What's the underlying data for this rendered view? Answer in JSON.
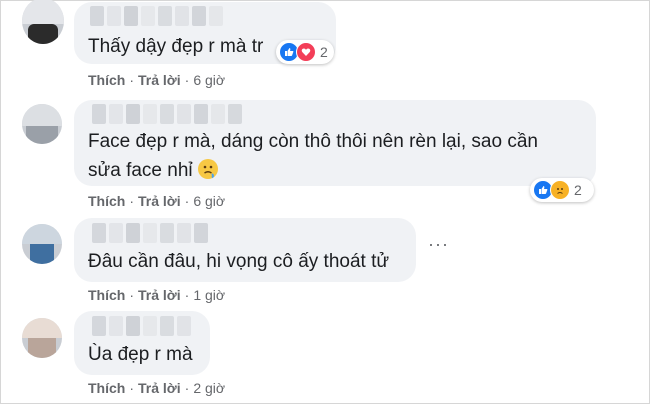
{
  "comments": [
    {
      "text": "Thấy dậy đẹp r mà tr",
      "like_label": "Thích",
      "reply_label": "Trả lời",
      "time": "6 giờ",
      "reactions": {
        "types": [
          "like-icon",
          "love-icon"
        ],
        "count": "2"
      }
    },
    {
      "text_line1": "Face đẹp r mà, dáng còn thô thôi nên rèn lại, sao cần",
      "text_line2": "sửa face nhỉ",
      "emoji": "thinking-sad-face-icon",
      "like_label": "Thích",
      "reply_label": "Trả lời",
      "time": "6 giờ",
      "reactions": {
        "types": [
          "like-icon",
          "sad-icon"
        ],
        "count": "2"
      }
    },
    {
      "text": "Đâu cần đâu, hi vọng cô ấy thoát tử",
      "like_label": "Thích",
      "reply_label": "Trả lời",
      "time": "1 giờ",
      "more_label": "···"
    },
    {
      "text": "Ùa đẹp r mà",
      "like_label": "Thích",
      "reply_label": "Trả lời",
      "time": "2 giờ"
    }
  ],
  "separator": "·",
  "colors": {
    "bubble": "#f0f2f5",
    "secondary_text": "#65676b",
    "like": "#1877f2",
    "love": "#f33e58",
    "sad": "#f7b125"
  }
}
